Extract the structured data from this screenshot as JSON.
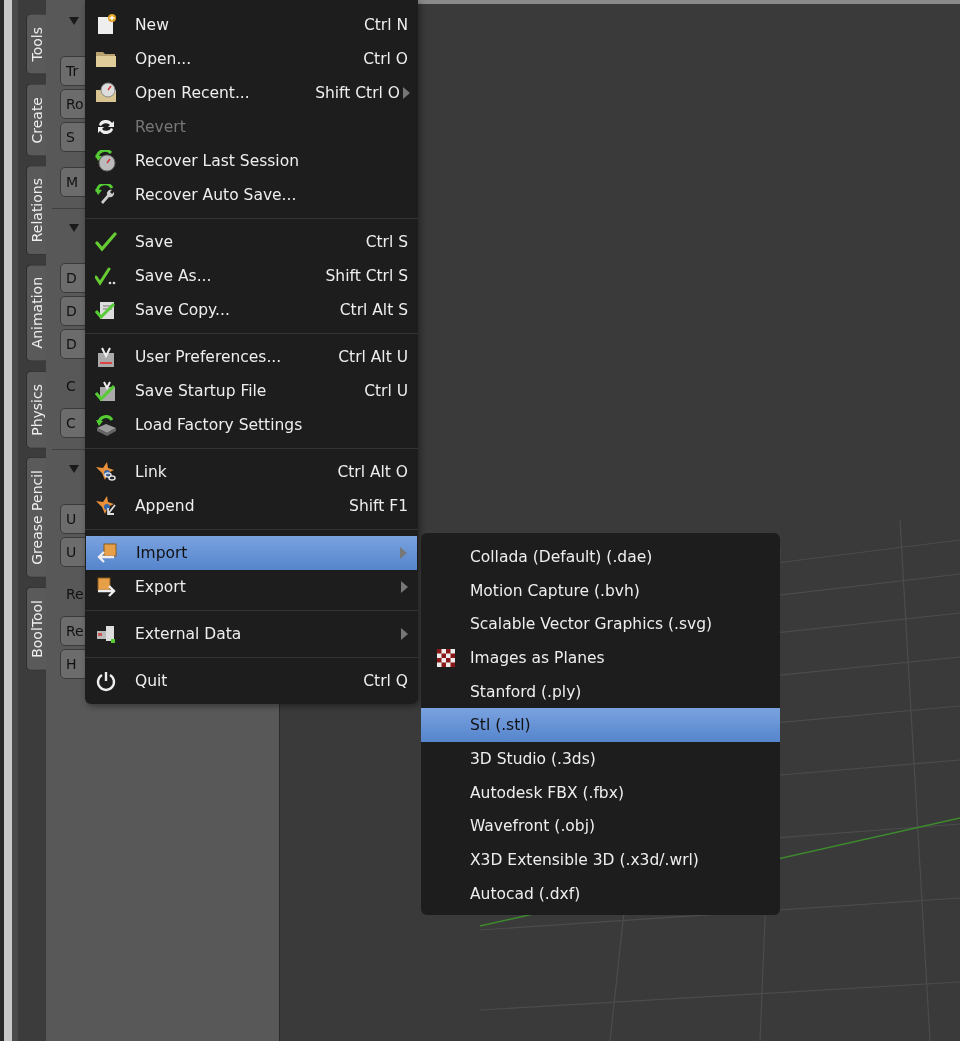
{
  "side_tabs": [
    {
      "label": "Tools"
    },
    {
      "label": "Create"
    },
    {
      "label": "Relations"
    },
    {
      "label": "Animation"
    },
    {
      "label": "Physics"
    },
    {
      "label": "Grease Pencil"
    },
    {
      "label": "BoolTool"
    }
  ],
  "panel": {
    "sections": [
      {
        "items": [
          {
            "kind": "button",
            "label": "Tr"
          },
          {
            "kind": "button",
            "label": "Ro"
          },
          {
            "kind": "button",
            "label": "S"
          },
          {
            "kind": "button",
            "label": "M",
            "gap": true
          }
        ]
      },
      {
        "items": [
          {
            "kind": "button",
            "label": "D"
          },
          {
            "kind": "button",
            "label": "D"
          },
          {
            "kind": "button",
            "label": "D"
          },
          {
            "kind": "label",
            "label": "C"
          },
          {
            "kind": "button",
            "label": "C"
          }
        ]
      },
      {
        "items": [
          {
            "kind": "button",
            "label": "U"
          },
          {
            "kind": "button",
            "label": "U"
          },
          {
            "kind": "label",
            "label": "Re"
          },
          {
            "kind": "button",
            "label": "Re"
          },
          {
            "kind": "button",
            "label": "H"
          }
        ]
      }
    ]
  },
  "file_menu": {
    "groups": [
      {
        "items": [
          {
            "label": "New",
            "shortcut": "Ctrl N",
            "disabled": false,
            "selected": false,
            "submenu": false
          },
          {
            "label": "Open...",
            "shortcut": "Ctrl O",
            "disabled": false,
            "selected": false,
            "submenu": false
          },
          {
            "label": "Open Recent...",
            "shortcut": "Shift Ctrl O",
            "disabled": false,
            "selected": false,
            "submenu": true
          },
          {
            "label": "Revert",
            "disabled": true,
            "selected": false,
            "submenu": false
          },
          {
            "label": "Recover Last Session",
            "disabled": false,
            "selected": false,
            "submenu": false
          },
          {
            "label": "Recover Auto Save...",
            "disabled": false,
            "selected": false,
            "submenu": false
          }
        ]
      },
      {
        "items": [
          {
            "label": "Save",
            "shortcut": "Ctrl S",
            "disabled": false,
            "selected": false,
            "submenu": false
          },
          {
            "label": "Save As...",
            "shortcut": "Shift Ctrl S",
            "disabled": false,
            "selected": false,
            "submenu": false
          },
          {
            "label": "Save Copy...",
            "shortcut": "Ctrl Alt S",
            "disabled": false,
            "selected": false,
            "submenu": false
          }
        ]
      },
      {
        "items": [
          {
            "label": "User Preferences...",
            "shortcut": "Ctrl Alt U",
            "disabled": false,
            "selected": false,
            "submenu": false
          },
          {
            "label": "Save Startup File",
            "shortcut": "Ctrl U",
            "disabled": false,
            "selected": false,
            "submenu": false
          },
          {
            "label": "Load Factory Settings",
            "disabled": false,
            "selected": false,
            "submenu": false
          }
        ]
      },
      {
        "items": [
          {
            "label": "Link",
            "shortcut": "Ctrl Alt O",
            "disabled": false,
            "selected": false,
            "submenu": false
          },
          {
            "label": "Append",
            "shortcut": "Shift F1",
            "disabled": false,
            "selected": false,
            "submenu": false
          }
        ]
      },
      {
        "items": [
          {
            "label": "Import",
            "disabled": false,
            "selected": true,
            "submenu": true
          },
          {
            "label": "Export",
            "disabled": false,
            "selected": false,
            "submenu": true
          }
        ]
      },
      {
        "items": [
          {
            "label": "External Data",
            "disabled": false,
            "selected": false,
            "submenu": true
          }
        ]
      },
      {
        "items": [
          {
            "label": "Quit",
            "shortcut": "Ctrl Q",
            "disabled": false,
            "selected": false,
            "submenu": false
          }
        ]
      }
    ]
  },
  "import_submenu": {
    "items": [
      {
        "label": "Collada (Default) (.dae)",
        "selected": false
      },
      {
        "label": "Motion Capture (.bvh)",
        "selected": false
      },
      {
        "label": "Scalable Vector Graphics (.svg)",
        "selected": false
      },
      {
        "label": "Images as Planes",
        "selected": false
      },
      {
        "label": "Stanford (.ply)",
        "selected": false
      },
      {
        "label": "Stl (.stl)",
        "selected": true
      },
      {
        "label": "3D Studio (.3ds)",
        "selected": false
      },
      {
        "label": "Autodesk FBX (.fbx)",
        "selected": false
      },
      {
        "label": "Wavefront (.obj)",
        "selected": false
      },
      {
        "label": "X3D Extensible 3D (.x3d/.wrl)",
        "selected": false
      },
      {
        "label": "Autocad (.dxf)",
        "selected": false
      }
    ]
  }
}
